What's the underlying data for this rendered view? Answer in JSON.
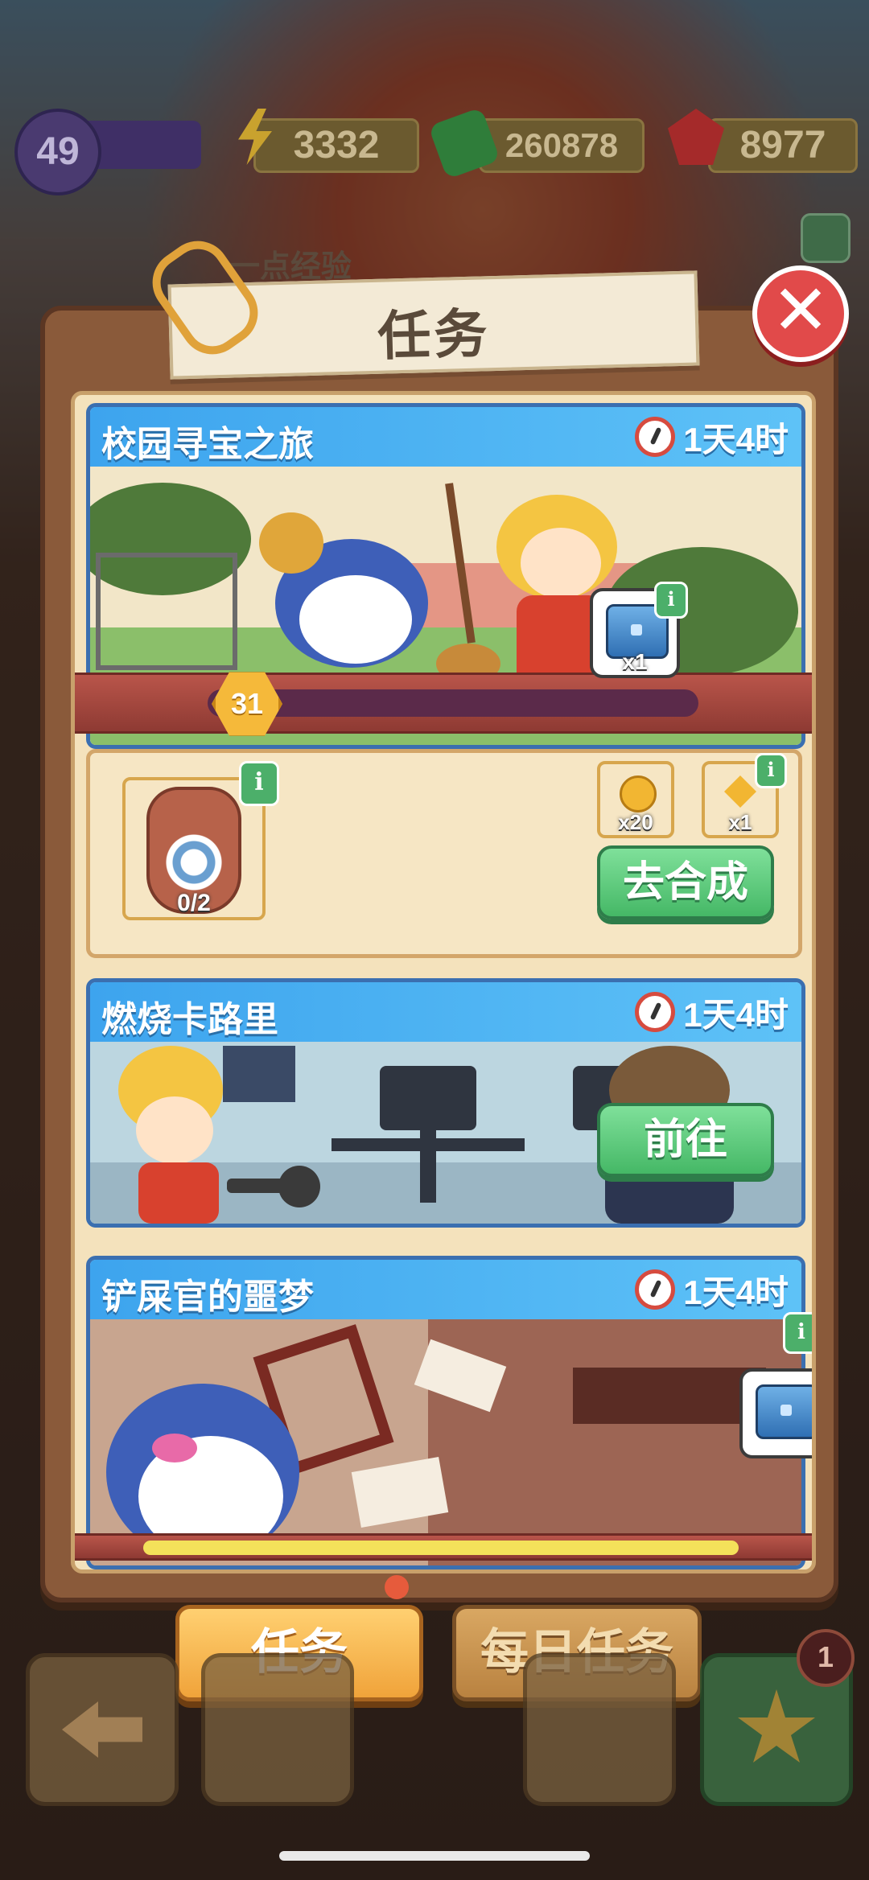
{
  "resources": {
    "level": "49",
    "energy": "3332",
    "cash": "260878",
    "gems": "8977"
  },
  "background": {
    "ghost_text": "一点经验"
  },
  "modal": {
    "title": "任务",
    "close_icon": "close-icon"
  },
  "tasks": [
    {
      "title": "校园寻宝之旅",
      "timer": "1天4时",
      "progress_level": "31",
      "reward": {
        "icon": "treasure-chest-icon",
        "count": "x1"
      },
      "merge": {
        "item_icon": "vase-icon",
        "item_progress": "0/2",
        "costs": [
          {
            "icon": "coin-icon",
            "count": "x20"
          },
          {
            "icon": "hourglass-icon",
            "count": "x1"
          }
        ],
        "button": "去合成"
      }
    },
    {
      "title": "燃烧卡路里",
      "timer": "1天4时",
      "button": "前往"
    },
    {
      "title": "铲屎官的噩梦",
      "timer": "1天4时",
      "reward": {
        "icon": "treasure-chest-icon"
      }
    }
  ],
  "tabs": {
    "active": "任务",
    "daily": "每日任务"
  },
  "bottom_nav": {
    "badge": "1"
  },
  "colors": {
    "header_blue": "#3da4ee",
    "button_green": "#45b866",
    "tab_orange": "#f0a33a",
    "close_red": "#e14a4a"
  }
}
